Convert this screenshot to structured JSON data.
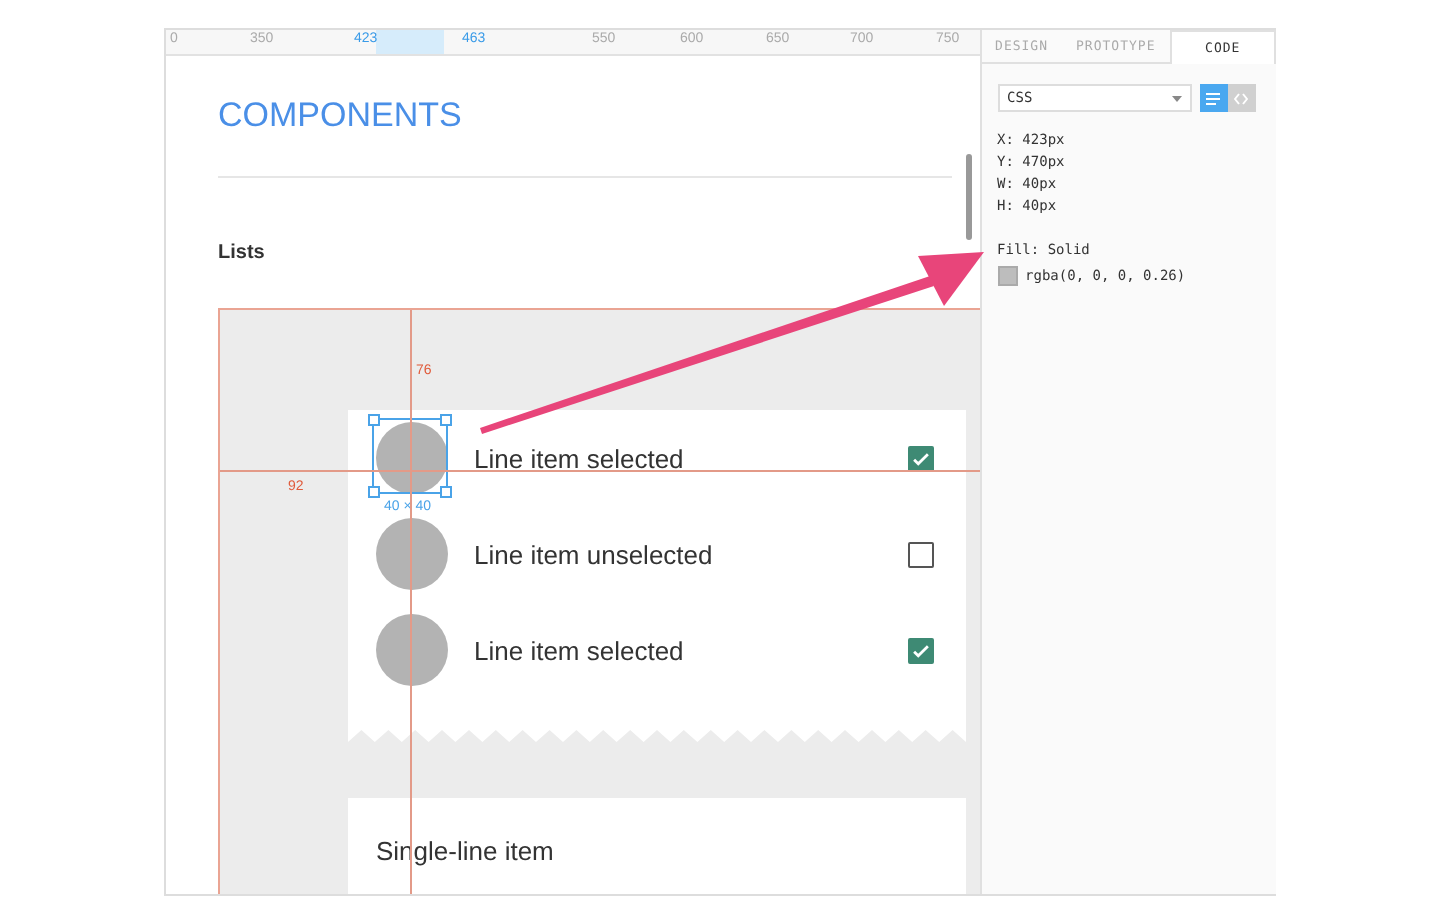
{
  "ruler": {
    "ticks": [
      {
        "label": "0",
        "highlighted": false
      },
      {
        "label": "350",
        "highlighted": false
      },
      {
        "label": "423",
        "highlighted": true
      },
      {
        "label": "463",
        "highlighted": true
      },
      {
        "label": "550",
        "highlighted": false
      },
      {
        "label": "600",
        "highlighted": false
      },
      {
        "label": "650",
        "highlighted": false
      },
      {
        "label": "700",
        "highlighted": false
      },
      {
        "label": "750",
        "highlighted": false
      }
    ]
  },
  "canvas": {
    "heading": "COMPONENTS",
    "section_title": "Lists",
    "top_distance": "76",
    "left_distance": "92",
    "selection_size": "40 × 40",
    "list_items": [
      {
        "label": "Line item selected",
        "checked": true,
        "selected": true
      },
      {
        "label": "Line item unselected",
        "checked": false,
        "selected": false
      },
      {
        "label": "Line item selected",
        "checked": true,
        "selected": false
      }
    ],
    "single_line_item": "Single-line item"
  },
  "panel": {
    "tabs": [
      {
        "label": "DESIGN",
        "selected": false
      },
      {
        "label": "PROTOTYPE",
        "selected": false
      },
      {
        "label": "CODE",
        "selected": true
      }
    ],
    "language": "CSS",
    "view_buttons": [
      {
        "kind": "lines",
        "selected": true
      },
      {
        "kind": "code",
        "selected": false
      }
    ],
    "properties": [
      "X: 423px",
      "Y: 470px",
      "W: 40px",
      "H: 40px"
    ],
    "fill_label": "Fill: Solid",
    "fill_value": "rgba(0, 0, 0, 0.26)"
  }
}
